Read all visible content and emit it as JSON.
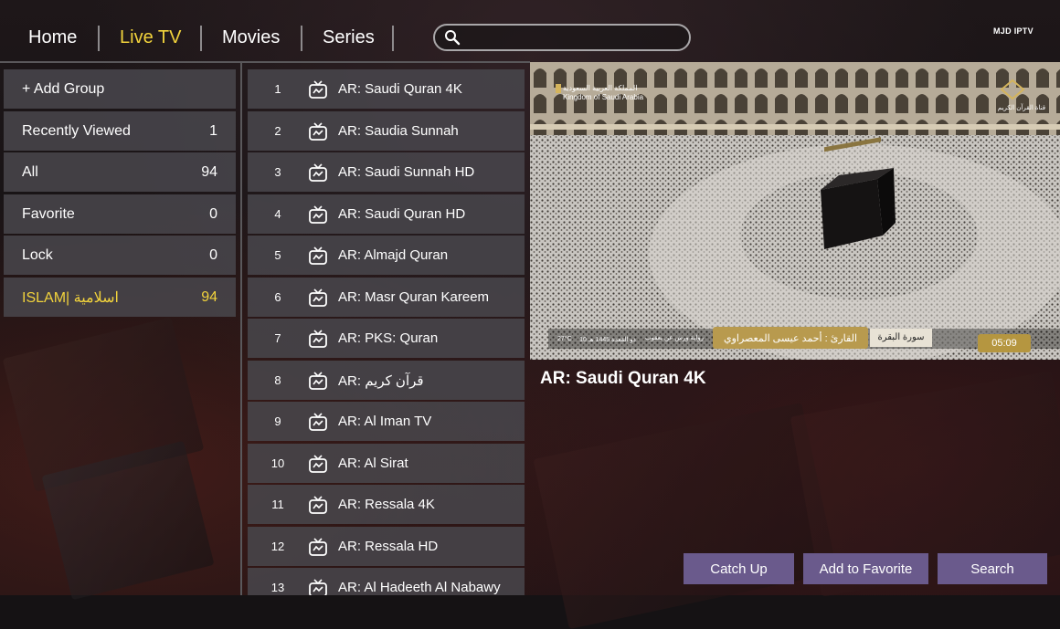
{
  "brand": "MJD IPTV",
  "nav": {
    "tabs": [
      {
        "label": "Home",
        "active": false
      },
      {
        "label": "Live TV",
        "active": true
      },
      {
        "label": "Movies",
        "active": false
      },
      {
        "label": "Series",
        "active": false
      }
    ]
  },
  "search": {
    "value": "",
    "placeholder": ""
  },
  "groups": [
    {
      "label": "+ Add Group",
      "count": ""
    },
    {
      "label": "Recently Viewed",
      "count": "1"
    },
    {
      "label": "All",
      "count": "94"
    },
    {
      "label": "Favorite",
      "count": "0"
    },
    {
      "label": "Lock",
      "count": "0"
    },
    {
      "label": "ISLAM| اسلامية",
      "count": "94",
      "active": true
    }
  ],
  "channels": [
    {
      "num": "1",
      "name": "AR: Saudi Quran 4K"
    },
    {
      "num": "2",
      "name": "AR: Saudia Sunnah"
    },
    {
      "num": "3",
      "name": "AR: Saudi Sunnah HD"
    },
    {
      "num": "4",
      "name": "AR: Saudi Quran HD"
    },
    {
      "num": "5",
      "name": "AR: Almajd Quran"
    },
    {
      "num": "6",
      "name": "AR: Masr Quran Kareem"
    },
    {
      "num": "7",
      "name": "AR: PKS: Quran"
    },
    {
      "num": "8",
      "name": "AR: قرآن كريم"
    },
    {
      "num": "9",
      "name": "AR: Al Iman TV"
    },
    {
      "num": "10",
      "name": "AR: Al Sirat"
    },
    {
      "num": "11",
      "name": "AR: Ressala 4K"
    },
    {
      "num": "12",
      "name": "AR: Ressala HD"
    },
    {
      "num": "13",
      "name": "AR: Al Hadeeth Al Nabawy"
    }
  ],
  "player": {
    "channel_title": "AR: Saudi Quran 4K",
    "overlay": {
      "logo_ar": "المملكة العربية السعودية",
      "logo_en": "Kingdom of Saudi Arabia",
      "channel_logo_ar": "قناة القرآن الكريم",
      "reciter": "القارئ : أحمد عيسى المعصراوي",
      "surah": "سورة البقرة",
      "riwaya": "رواية ورش عن يعقوب",
      "date": "10 ذو القعدة 1445 هـ",
      "temp": "27°C",
      "time": "05:09"
    }
  },
  "actions": {
    "catch_up": "Catch Up",
    "add_favorite": "Add to Favorite",
    "search": "Search"
  },
  "colors": {
    "accent": "#f2d33c",
    "button": "#6a5a8c",
    "item_bg": "#48454b"
  }
}
